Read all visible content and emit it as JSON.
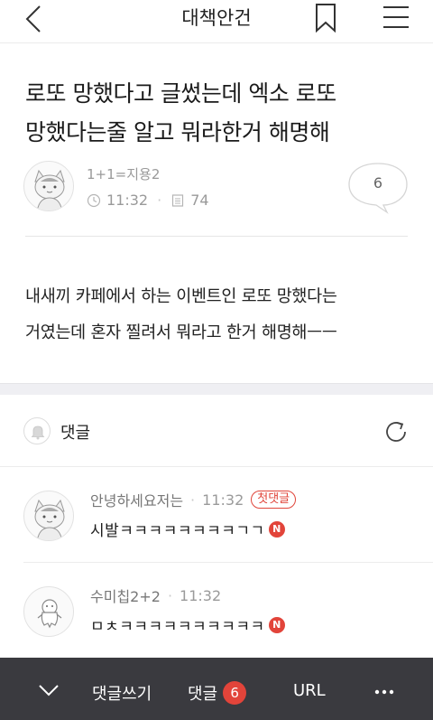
{
  "topbar": {
    "title": "대책안건",
    "back_icon": "chevron-left-icon",
    "bookmark_icon": "bookmark-icon",
    "menu_icon": "hamburger-menu-icon"
  },
  "post": {
    "title_line1": "로또 망했다고 글썼는데 엑소 로또",
    "title_line2": "망했다는줄 알고 뭐라한거 해명해",
    "author": "1+1=지용2",
    "time": "11:32",
    "views": "74",
    "comment_count": "6",
    "body_line1": "내새끼 카페에서 하는 이벤트인 로또 망했다는",
    "body_line2": "거였는데 혼자 찔려서 뭐라고 한거 해명해ㅡㅡ"
  },
  "comments_section": {
    "label": "댓글",
    "items": [
      {
        "author": "안녕하세요저는",
        "time": "11:32",
        "badge": "첫댓글",
        "text": "시발ㅋㅋㅋㅋㅋㅋㅋㅋㄱㄱ",
        "new_badge": "N"
      },
      {
        "author": "수미칩2+2",
        "time": "11:32",
        "text": "ㅁㅊㅋㅋㅋㅋㅋㅋㅋㅋㅋㅋ",
        "new_badge": "N"
      }
    ]
  },
  "bottombar": {
    "write_comment": "댓글쓰기",
    "comments": "댓글",
    "comments_count": "6",
    "url": "URL"
  },
  "colors": {
    "accent_red": "#e2443a",
    "bottom_bar": "#3a3a3f",
    "muted_text": "#9a9a9a"
  }
}
